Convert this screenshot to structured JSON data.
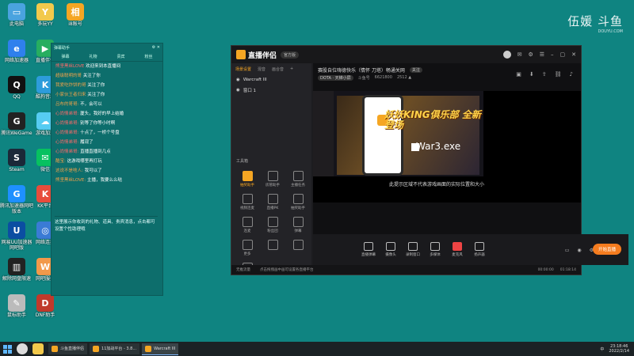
{
  "brand": {
    "title": "伍媛 斗鱼",
    "sub": "DOUYU.COM"
  },
  "desktop_icons": [
    {
      "label": "此电脑",
      "color": "#4aa3df",
      "glyph": "▭"
    },
    {
      "label": "多玩YY",
      "color": "#f2c94c",
      "glyph": "Y"
    },
    {
      "label": "i8账号",
      "color": "#f5a623",
      "glyph": "相"
    },
    {
      "label": "网络加速器",
      "color": "#2f80ed",
      "glyph": "e"
    },
    {
      "label": "直播伴侣",
      "color": "#27ae60",
      "glyph": "▶"
    },
    {
      "label": "QQ",
      "color": "#111",
      "glyph": "Q"
    },
    {
      "label": "酷狗音乐",
      "color": "#2d9cdb",
      "glyph": "K"
    },
    {
      "label": "腾讯WeGame",
      "color": "#222",
      "glyph": "G"
    },
    {
      "label": "游戏加速",
      "color": "#56ccf2",
      "glyph": "☁"
    },
    {
      "label": "Steam",
      "color": "#1b2838",
      "glyph": "S"
    },
    {
      "label": "微信",
      "color": "#07c160",
      "glyph": "✉"
    },
    {
      "label": "腾讯加速器网吧版本",
      "color": "#1e90ff",
      "glyph": "G"
    },
    {
      "label": "KK平台",
      "color": "#e74c3c",
      "glyph": "K"
    },
    {
      "label": "网易UU加速器网吧版",
      "color": "#0b4ea2",
      "glyph": "U"
    },
    {
      "label": "网络连接",
      "color": "#3a7bd5",
      "glyph": "◎"
    },
    {
      "label": "解除网盘限速",
      "color": "#222",
      "glyph": "▥"
    },
    {
      "label": "网吧服务",
      "color": "#f2994a",
      "glyph": "W"
    },
    {
      "label": "鼠标助手",
      "color": "#bbb",
      "glyph": "✎"
    },
    {
      "label": "DNF助手",
      "color": "#c0392b",
      "glyph": "D"
    }
  ],
  "chat": {
    "header": "弹幕助手",
    "tabs": [
      "弹幕",
      "礼物",
      "贵宾",
      "粉丝"
    ],
    "messages": [
      {
        "name": "熊坚黑丝LOVE",
        "text": "欢迎来到本直播间",
        "red": true
      },
      {
        "name": "超级聪明的哥",
        "text": "关注了你",
        "red": false
      },
      {
        "name": "我爱吃炸饼的哥",
        "text": "关注了你",
        "red": false
      },
      {
        "name": "小家伙王者归来",
        "text": "关注了你",
        "red": false
      },
      {
        "name": "吕布的哥哥:",
        "text": "不，会可以",
        "red": false
      },
      {
        "name": "心尚情弟哥:",
        "text": "厦头，我好的早上结婚",
        "red": true
      },
      {
        "name": "心尚情弟哥:",
        "text": "别等了你等小时啊",
        "red": true
      },
      {
        "name": "心尚情弟哥:",
        "text": "十点了，一桥个号盘",
        "red": true
      },
      {
        "name": "心尚情弟哥:",
        "text": "履现了",
        "red": true
      },
      {
        "name": "心尚情弟哥:",
        "text": "直播直播到几点",
        "red": true
      },
      {
        "name": "酷宝:",
        "text": "这游戏哪里再打玩",
        "red": false
      },
      {
        "name": "这说不是啥人:",
        "text": "我可以了",
        "red": false
      },
      {
        "name": "熊坚黑丝LOVE:",
        "text": "主播，我要么么哒",
        "red": false
      }
    ],
    "note": "这里展示你收到的礼物、道具、贵宾消息，点击都可设置个性助理哦"
  },
  "app": {
    "title": "直播伴侣",
    "version": "官方版",
    "left_tabs": [
      "场景设置",
      "混音",
      "画合音"
    ],
    "sources": [
      "Warcraft III",
      "窗口 1"
    ],
    "tools_label": "工具箱",
    "tools": [
      "抽奖助手",
      "房管助手",
      "主播任务",
      "视频连麦",
      "直播PK",
      "抽奖助手",
      "连麦",
      "粉丝团",
      "弹幕",
      "更多",
      "",
      "",
      ""
    ],
    "stream_title": "赛股自位嗨德快乐（情怀 刀塔）畅通关网",
    "game_tag": "DOTA · 天梯小屏",
    "meta": [
      "斗鱼号",
      "6621800",
      "2512 ▲"
    ],
    "follow": "关注",
    "watermark": "War3.exe",
    "king": "妖妖KING俱乐部 全新登场",
    "hint": "此提示区域不代表游戏画面的实际位置和大小",
    "bottom": [
      "直播弹幕",
      "摄像头",
      "录制窗口",
      "多媒体",
      "麦克风",
      "扬声器"
    ],
    "golive": "开始直播",
    "status_left": "无推流量",
    "status_mid": "点击拖拽画中画可设置各直播平台",
    "status_time": "00:00:00",
    "status_right": "01:18:14"
  },
  "taskbar": {
    "tasks": [
      {
        "label": "斗鱼直播伴侣",
        "on": false
      },
      {
        "label": "11加战平台 - 3.8...",
        "on": false
      },
      {
        "label": "Warcraft III",
        "on": true
      }
    ],
    "lang": "中",
    "time": "23:18:46",
    "date": "2022/2/14"
  }
}
